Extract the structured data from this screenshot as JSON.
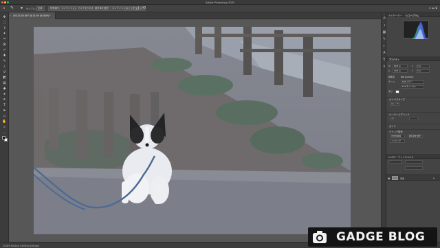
{
  "window": {
    "title": "Adobe Photoshop 2020"
  },
  "options_bar": {
    "labels": [
      "サンプル:",
      "全体",
      "境界線を調整",
      "コンテンツに応じる",
      "マスクをかける",
      "被写体を選択",
      "コンテンツに応じた塗りつぶし"
    ],
    "icons": [
      "home-icon",
      "brush-icon",
      "angle-icon",
      "search-icon",
      "workspace-icon",
      "share-icon"
    ]
  },
  "document": {
    "tab_label": "DSC01105.NEF @ 33.3% (RGB/8*) *"
  },
  "tools": {
    "icons": [
      "move-icon",
      "marquee-icon",
      "lasso-icon",
      "quick-select-icon",
      "crop-icon",
      "eyedropper-icon",
      "heal-icon",
      "brush-icon",
      "stamp-icon",
      "history-brush-icon",
      "eraser-icon",
      "gradient-icon",
      "blur-icon",
      "dodge-icon",
      "pen-icon",
      "type-icon",
      "path-select-icon",
      "shape-icon",
      "hand-icon",
      "zoom-icon",
      "more-icon"
    ],
    "foreground_color": "#111111",
    "background_color": "#ffffff"
  },
  "panels": {
    "tabs_top": [
      "ナビゲーター",
      "ヒストグラム"
    ],
    "histogram_colors": [
      "#ff3b3b",
      "#39d23a",
      "#3a6bff",
      "#ffffff"
    ],
    "properties": {
      "title": "プロパティ",
      "fields": [
        {
          "label": "W",
          "value": "6016 px"
        },
        {
          "label": "H",
          "value": "4016 px"
        },
        {
          "label": "X",
          "value": "0 px"
        },
        {
          "label": "Y",
          "value": "0 px"
        }
      ],
      "resolution_label": "解像度:",
      "resolution_value": "300 pixel/inch",
      "mode_label": "モード:",
      "mode_value": "RGB カラー",
      "depth_value": "8 bit/チャンネル",
      "fill_label": "塗り"
    },
    "sections": [
      {
        "title": "カンバスサイズ"
      },
      {
        "title": "ルーラーとグリッド"
      },
      {
        "title": "ガイド"
      },
      {
        "title": "クイック操作"
      }
    ],
    "quick_buttons": [
      "背景を削除",
      "被写体を選択",
      "トリミング"
    ],
    "layers": {
      "tabs": [
        "レイヤー",
        "チャンネル",
        "パス"
      ],
      "rows": [
        {
          "name": "背景"
        }
      ]
    }
  },
  "status_bar": {
    "text": "33.33%    6016 px x 4016 px (300 ppi)"
  },
  "watermark": {
    "text": "GADGE BLOG"
  }
}
